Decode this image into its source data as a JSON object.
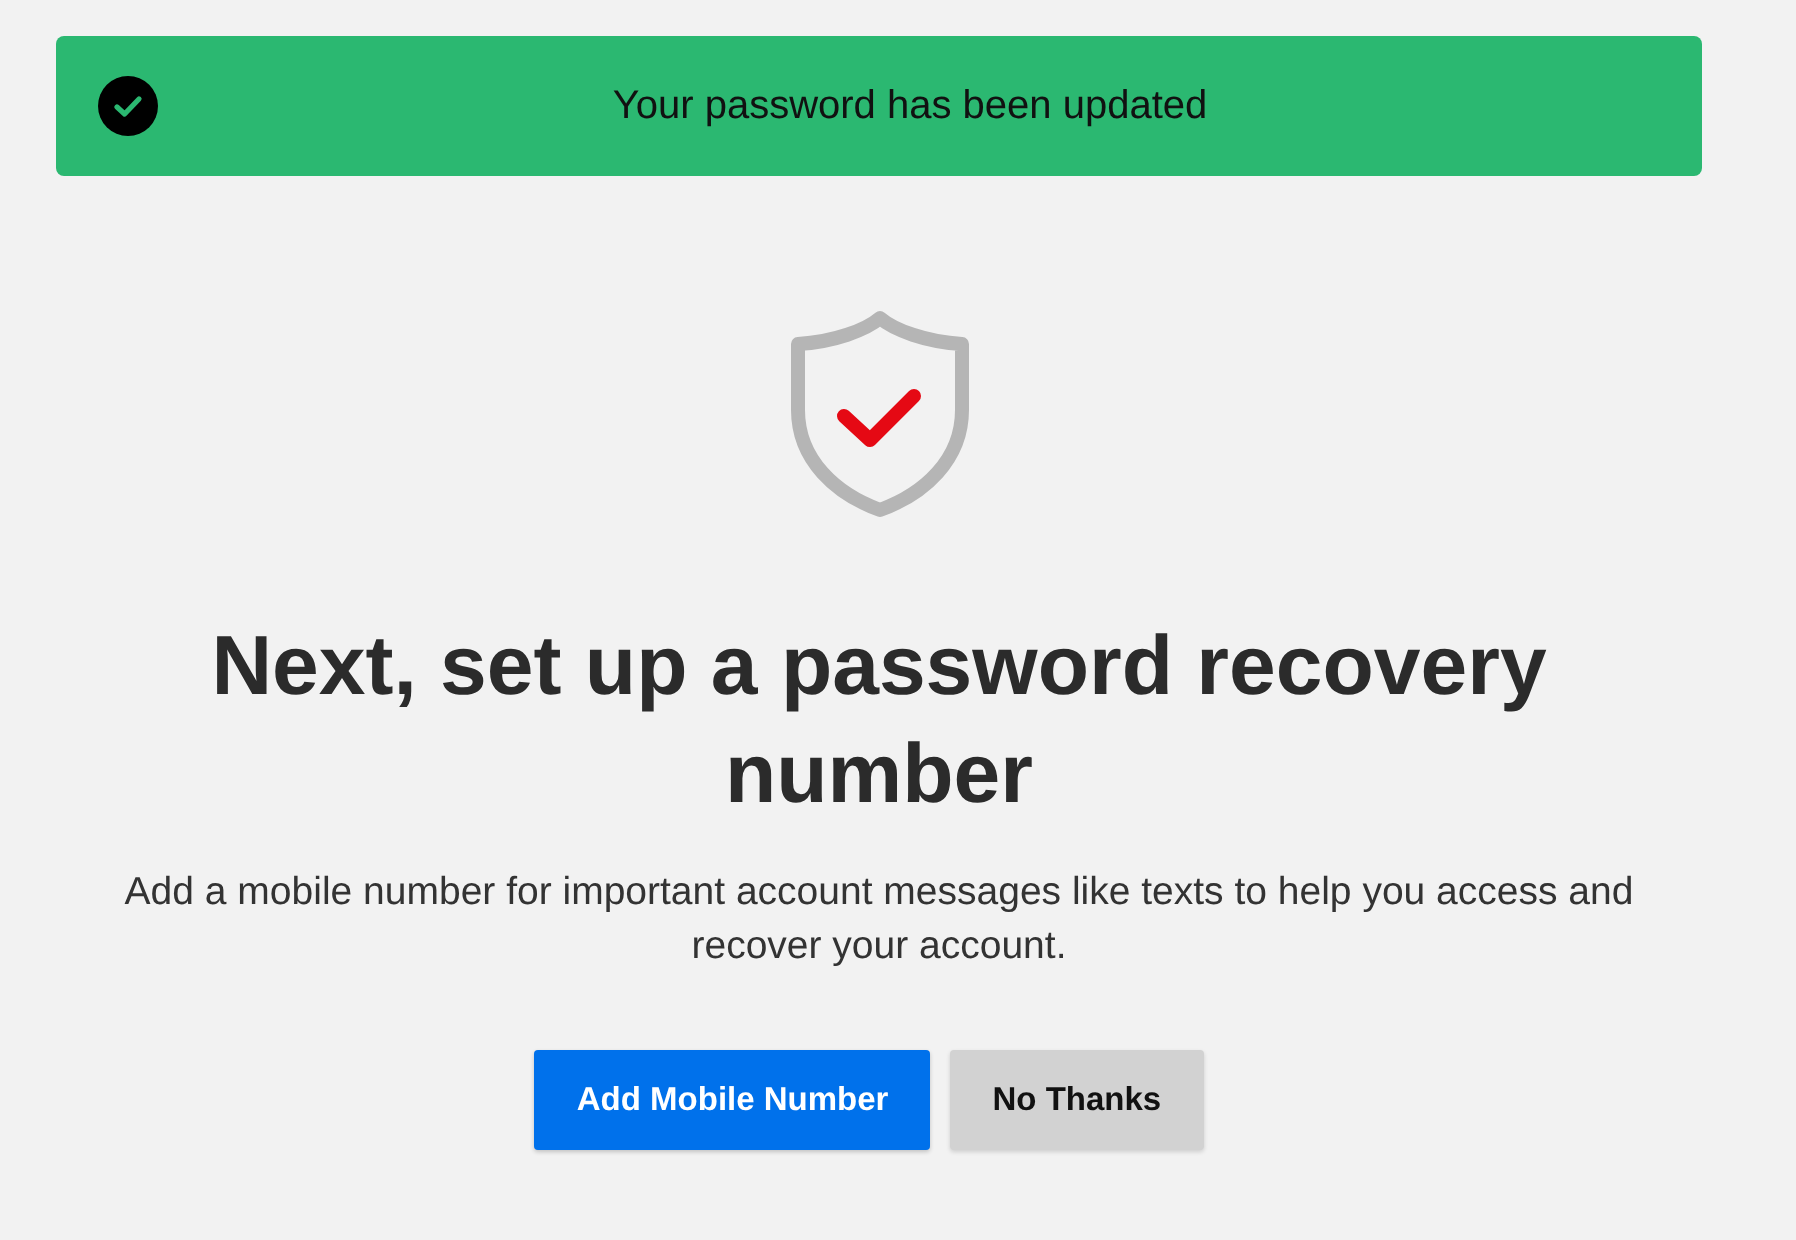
{
  "banner": {
    "message": "Your password has been updated"
  },
  "heading": "Next, set up a password recovery number",
  "description": "Add a mobile number for important account messages like texts to help you access and recover your account.",
  "buttons": [
    {
      "label": "Add Mobile Number",
      "kind": "primary"
    },
    {
      "label": "No Thanks",
      "kind": "secondary"
    }
  ]
}
